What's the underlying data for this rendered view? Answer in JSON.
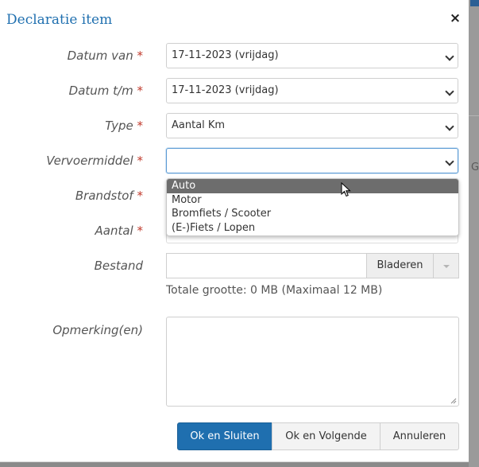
{
  "dialog": {
    "title": "Declaratie item",
    "close_glyph": "×"
  },
  "required_marker": "*",
  "fields": {
    "datum_van": {
      "label": "Datum van",
      "value": "17-11-2023 (vrijdag)"
    },
    "datum_tm": {
      "label": "Datum t/m",
      "value": "17-11-2023 (vrijdag)"
    },
    "type": {
      "label": "Type",
      "value": "Aantal Km"
    },
    "vervoermiddel": {
      "label": "Vervoermiddel",
      "value": "",
      "options": [
        "Auto",
        "Motor",
        "Bromfiets / Scooter",
        "(E-)Fiets / Lopen"
      ],
      "highlighted_option": "Auto"
    },
    "brandstof": {
      "label": "Brandstof"
    },
    "aantal": {
      "label": "Aantal"
    },
    "bestand": {
      "label": "Bestand",
      "browse_label": "Bladeren",
      "size_note": "Totale grootte: 0 MB (Maximaal 12 MB)"
    },
    "opmerkingen": {
      "label": "Opmerking(en)",
      "value": ""
    }
  },
  "buttons": {
    "ok_close": "Ok en Sluiten",
    "ok_next": "Ok en Volgende",
    "cancel": "Annuleren"
  },
  "icons": {
    "close": "close-icon",
    "chevron": "chevron-down-icon",
    "cursor": "mouse-pointer-icon",
    "resize": "resize-grip-icon"
  },
  "colors": {
    "accent": "#1f6faf",
    "required": "#c0392b",
    "highlight": "#6d6d6d"
  }
}
